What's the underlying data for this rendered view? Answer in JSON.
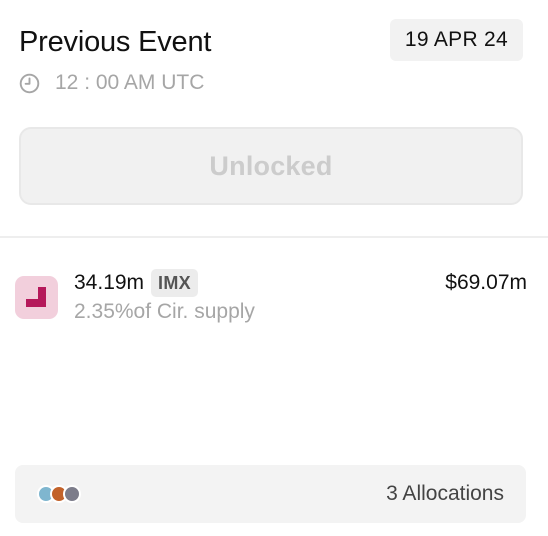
{
  "event": {
    "title": "Previous Event",
    "date": "19 APR 24",
    "time": "12 : 00 AM UTC"
  },
  "unlock_button": {
    "label": "Unlocked"
  },
  "token": {
    "amount": "34.19m",
    "symbol": "IMX",
    "supply_text": "2.35%of Cir. supply",
    "value": "$69.07m",
    "logo_color": "#b5185a",
    "logo_bg": "#f2cfdc"
  },
  "allocations": {
    "label": "3 Allocations",
    "dot_colors": [
      "#7fb6cf",
      "#c2622a",
      "#7c7c8a"
    ]
  },
  "colors": {
    "muted_text": "#a6a6a6",
    "badge_bg": "#f2f2f2"
  }
}
